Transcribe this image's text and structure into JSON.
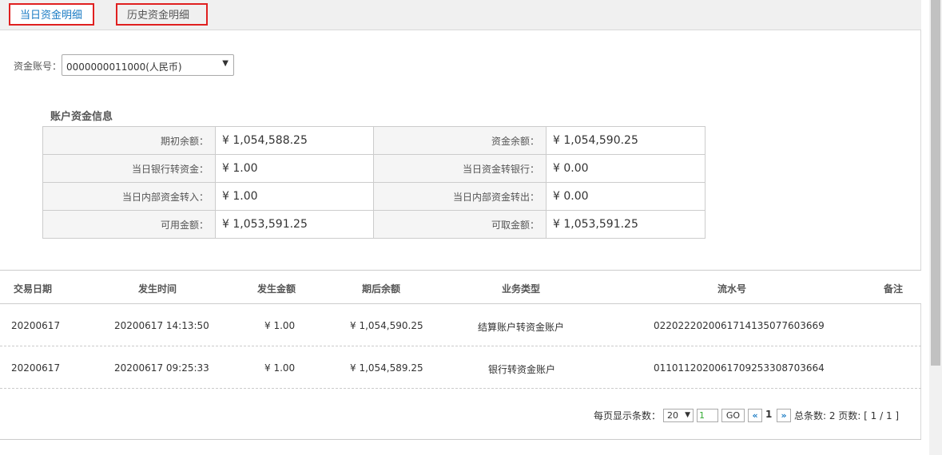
{
  "tabs": {
    "today": "当日资金明细",
    "history": "历史资金明细"
  },
  "account": {
    "label": "资金账号：",
    "value": "0000000011000(人民币)",
    "arrow": "▼"
  },
  "info": {
    "title": "账户资金信息",
    "rows": [
      {
        "l1": "期初余额：",
        "v1": "¥ 1,054,588.25",
        "l2": "资金余额：",
        "v2": "¥ 1,054,590.25"
      },
      {
        "l1": "当日银行转资金：",
        "v1": "¥ 1.00",
        "l2": "当日资金转银行：",
        "v2": "¥ 0.00"
      },
      {
        "l1": "当日内部资金转入：",
        "v1": "¥ 1.00",
        "l2": "当日内部资金转出：",
        "v2": "¥ 0.00"
      },
      {
        "l1": "可用金额：",
        "v1": "¥ 1,053,591.25",
        "l2": "可取金额：",
        "v2": "¥ 1,053,591.25"
      }
    ]
  },
  "table": {
    "headers": [
      "交易日期",
      "发生时间",
      "发生金额",
      "期后余额",
      "业务类型",
      "流水号",
      "备注"
    ],
    "rows": [
      [
        "20200617",
        "20200617 14:13:50",
        "¥ 1.00",
        "¥ 1,054,590.25",
        "结算账户转资金账户",
        "02202220200617141350776036​69",
        ""
      ],
      [
        "20200617",
        "20200617 09:25:33",
        "¥ 1.00",
        "¥ 1,054,589.25",
        "银行转资金账户",
        "01101120200617092533087036​64",
        ""
      ]
    ]
  },
  "pager": {
    "per_page_label": "每页显示条数：",
    "per_page": "20",
    "arrow": "▼",
    "page_input": "1",
    "go": "GO",
    "prev": "«",
    "current": "1",
    "next": "»",
    "summary": "总条数: 2 页数: [ 1 / 1 ]"
  }
}
